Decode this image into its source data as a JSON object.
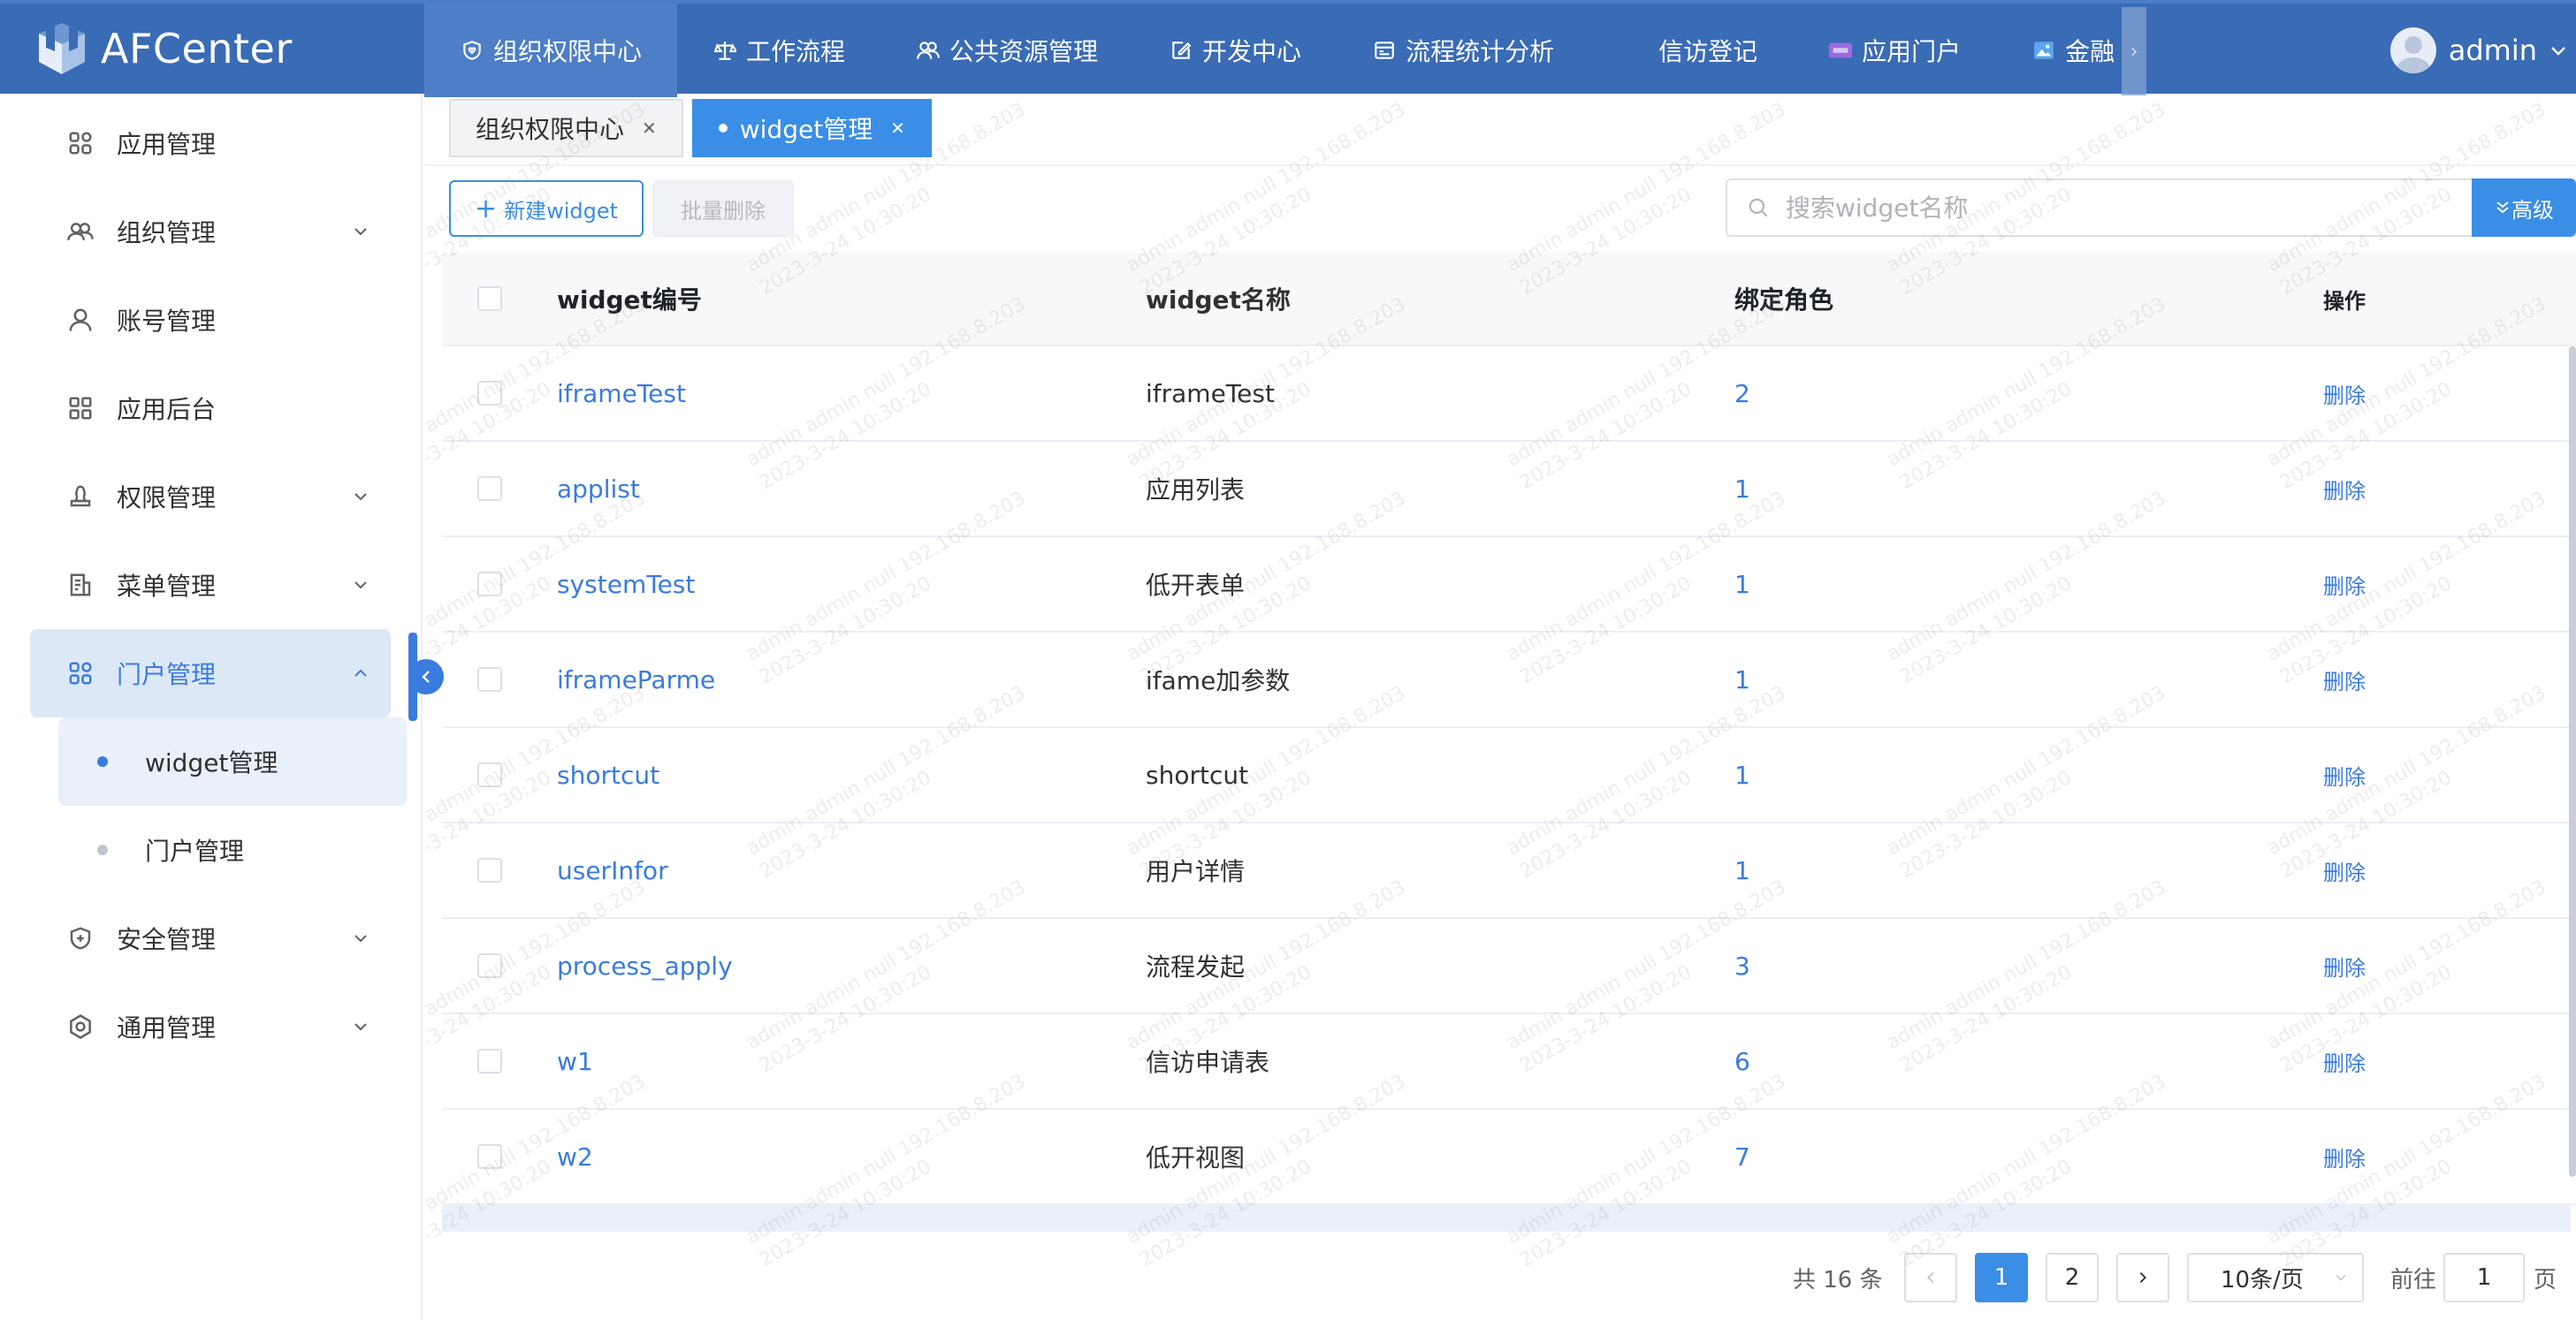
{
  "app": {
    "name": "AFCenter"
  },
  "topnav": {
    "items": [
      {
        "label": "组织权限中心",
        "icon": "shield-heart-icon",
        "active": true
      },
      {
        "label": "工作流程",
        "icon": "scale-icon"
      },
      {
        "label": "公共资源管理",
        "icon": "users-icon"
      },
      {
        "label": "开发中心",
        "icon": "edit-icon"
      },
      {
        "label": "流程统计分析",
        "icon": "chart-window-icon"
      },
      {
        "label": "信访登记",
        "icon": ""
      },
      {
        "label": "应用门户",
        "icon": "portal-icon"
      },
      {
        "label": "金融",
        "icon": "image-icon"
      }
    ],
    "user": "admin"
  },
  "sidebar": {
    "items": [
      {
        "label": "应用管理",
        "icon": "apps-grid-icon",
        "expandable": false
      },
      {
        "label": "组织管理",
        "icon": "org-icon",
        "expandable": true
      },
      {
        "label": "账号管理",
        "icon": "user-icon",
        "expandable": false
      },
      {
        "label": "应用后台",
        "icon": "backend-grid-icon",
        "expandable": false
      },
      {
        "label": "权限管理",
        "icon": "stamp-icon",
        "expandable": true
      },
      {
        "label": "菜单管理",
        "icon": "menu-doc-icon",
        "expandable": true
      },
      {
        "label": "门户管理",
        "icon": "portal-grid-icon",
        "expandable": true,
        "open": true
      },
      {
        "label": "安全管理",
        "icon": "shield-plus-icon",
        "expandable": true
      },
      {
        "label": "通用管理",
        "icon": "settings-ring-icon",
        "expandable": true
      }
    ],
    "portal_sub": [
      {
        "label": "widget管理",
        "active": true
      },
      {
        "label": "门户管理",
        "active": false
      }
    ]
  },
  "tabs": [
    {
      "label": "组织权限中心",
      "active": false
    },
    {
      "label": "widget管理",
      "active": true
    }
  ],
  "toolbar": {
    "new_label": "新建widget",
    "batch_delete_label": "批量删除",
    "search_placeholder": "搜索widget名称",
    "advanced_label": "高级"
  },
  "table": {
    "columns": [
      "widget编号",
      "widget名称",
      "绑定角色",
      "操作"
    ],
    "rows": [
      {
        "id": "iframeTest",
        "name": "iframeTest",
        "roles": "2",
        "op": "删除"
      },
      {
        "id": "applist",
        "name": "应用列表",
        "roles": "1",
        "op": "删除"
      },
      {
        "id": "systemTest",
        "name": "低开表单",
        "roles": "1",
        "op": "删除"
      },
      {
        "id": "iframeParme",
        "name": "ifame加参数",
        "roles": "1",
        "op": "删除"
      },
      {
        "id": "shortcut",
        "name": "shortcut",
        "roles": "1",
        "op": "删除"
      },
      {
        "id": "userInfor",
        "name": "用户详情",
        "roles": "1",
        "op": "删除"
      },
      {
        "id": "process_apply",
        "name": "流程发起",
        "roles": "3",
        "op": "删除"
      },
      {
        "id": "w1",
        "name": "信访申请表",
        "roles": "6",
        "op": "删除"
      },
      {
        "id": "w2",
        "name": "低开视图",
        "roles": "7",
        "op": "删除"
      }
    ]
  },
  "pagination": {
    "total_label": "共 16 条",
    "pages": [
      "1",
      "2"
    ],
    "current_page": "1",
    "page_size_label": "10条/页",
    "goto_label": "前往",
    "goto_value": "1",
    "page_suffix": "页"
  },
  "watermark": {
    "line1": "admin admin null 192.168.8.203",
    "line2": "2023-3-24 10:30:20"
  },
  "colors": {
    "topbar": "#3a6bb5",
    "accent": "#3a8ee6",
    "link": "#3a7be0"
  }
}
